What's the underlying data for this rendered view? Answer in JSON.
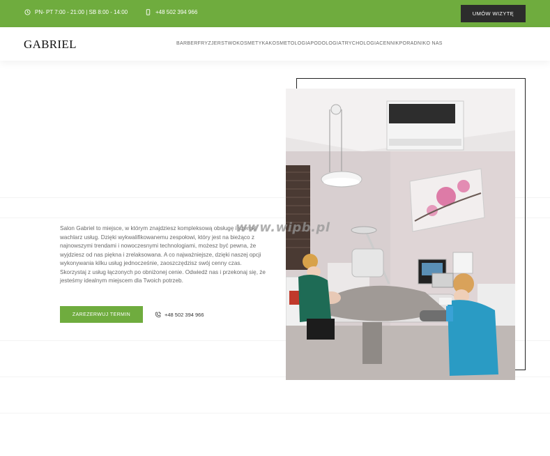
{
  "topbar": {
    "hours": "PN- PT 7:00 - 21:00 | SB 8:00 - 14:00",
    "phone": "+48 502 394 966",
    "book_label": "UMÓW WIZYTĘ",
    "bg_color": "#6fac3e"
  },
  "header": {
    "logo": "GABRIEL",
    "nav": [
      "BARBER",
      "FRYZJERSTWO",
      "KOSMETYKA",
      "KOSMETOLOGIA",
      "PODOLOGIA",
      "TRYCHOLOGIA",
      "CENNIK",
      "PORADNIK",
      "O NAS"
    ]
  },
  "hero": {
    "text": "Salon Gabriel to miejsce, w którym znajdziesz kompleksową obsługę i szeroki wachlarz usług. Dzięki wykwalifikowanemu zespołowi, który jest na bieżąco z najnowszymi trendami i nowoczesnymi technologiami, możesz być pewna, że wyjdziesz od nas piękna i zrelaksowana. A co najważniejsze, dzięki naszej opcji wykonywania kilku usług jednocześnie, zaoszczędzisz swój cenny czas. Skorzystaj z usług łączonych po obniżonej cenie. Odwiedź nas i przekonaj się, że jesteśmy idealnym miejscem dla Twoich potrzeb.",
    "cta_label": "ZAREZERWUJ TERMIN",
    "phone": "+48 502 394 966"
  },
  "image": {
    "watermark": "www.wipb.pl"
  },
  "icons": {
    "clock": "clock-icon",
    "mobile": "mobile-phone-icon",
    "phone": "phone-icon"
  }
}
